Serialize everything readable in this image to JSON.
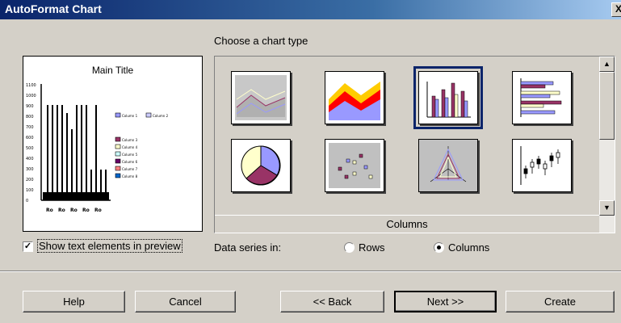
{
  "window": {
    "title": "AutoFormat Chart",
    "close_label": "X"
  },
  "preview": {
    "title": "Main Title",
    "y_ticks": [
      "1100",
      "1000",
      "900",
      "800",
      "700",
      "600",
      "500",
      "400",
      "300",
      "200",
      "100",
      "0"
    ],
    "x_ticks": [
      "Ro",
      "Ro",
      "Ro",
      "Ro",
      "Ro"
    ],
    "legend": [
      "Column 1",
      "Column 2",
      "Column 3",
      "Column 4",
      "Column 5",
      "Column 6",
      "Column 7",
      "Column 8"
    ],
    "show_text_checked": true,
    "show_text_label": "Show text elements in preview"
  },
  "gallery": {
    "label": "Choose a chart type",
    "selected_caption": "Columns",
    "tiles": [
      {
        "icon": "area-3d-icon"
      },
      {
        "icon": "stacked-area-icon"
      },
      {
        "icon": "column-chart-icon",
        "selected": true
      },
      {
        "icon": "bar-chart-icon"
      },
      {
        "icon": "pie-chart-icon"
      },
      {
        "icon": "scatter-chart-icon"
      },
      {
        "icon": "net-chart-icon"
      },
      {
        "icon": "stock-chart-icon"
      }
    ]
  },
  "data_series": {
    "label": "Data series in:",
    "rows_label": "Rows",
    "columns_label": "Columns",
    "selected": "columns"
  },
  "buttons": {
    "help": "Help",
    "cancel": "Cancel",
    "back": "<< Back",
    "next": "Next >>",
    "create": "Create"
  },
  "colors": {
    "titlebar": "#0a246a",
    "dialog": "#d4d0c8",
    "selection": "#0a246a"
  }
}
